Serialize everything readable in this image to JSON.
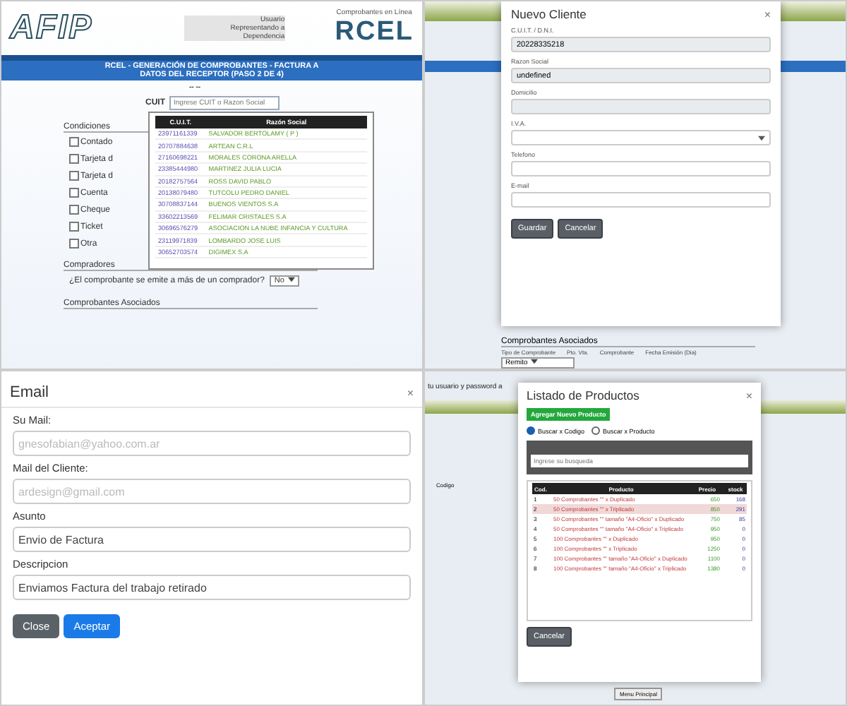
{
  "afip_panel": {
    "logo": "AFIP",
    "header_labels": [
      "Usuario",
      "Representando a",
      "Dependencia"
    ],
    "brand_caption": "Comprobantes en Línea",
    "brand": "RCEL",
    "title_lines": [
      "RCEL - GENERACIÓN DE COMPROBANTES - FACTURA A",
      "DATOS DEL RECEPTOR (PASO 2 DE 4)"
    ],
    "step": "-- --",
    "cuit_label": "CUIT",
    "cuit_placeholder": "Ingrese CUIT o Razon Social",
    "suggestions": {
      "columns": [
        "C.U.I.T.",
        "Razón Social"
      ],
      "rows": [
        {
          "cuit": "23971161339",
          "name": "SALVADOR BERTOLAMY ( P )"
        },
        {
          "cuit": "20707884638",
          "name": "ARTEAN C.R.L"
        },
        {
          "cuit": "27160698221",
          "name": "MORALES CORONA ARELLA"
        },
        {
          "cuit": "23385444980",
          "name": "MARTINEZ JULIA LUCIA"
        },
        {
          "cuit": "20182757564",
          "name": "ROSS DAVID PABLO"
        },
        {
          "cuit": "20138079480",
          "name": "TUTCOLU PEDRO DANIEL"
        },
        {
          "cuit": "30708837144",
          "name": "BUENOS VIENTOS S.A"
        },
        {
          "cuit": "33602213569",
          "name": "FELIMAR CRISTALES S.A"
        },
        {
          "cuit": "30696576279",
          "name": "ASOCIACION LA NUBE INFANCIA Y CULTURA"
        },
        {
          "cuit": "23119971839",
          "name": "LOMBARDO JOSE LUIS"
        },
        {
          "cuit": "30652703574",
          "name": "DIGIMEX S.A"
        }
      ]
    },
    "conditions_label": "Condiciones",
    "conditions": [
      {
        "label": "Contado",
        "checked": false
      },
      {
        "label": "Tarjeta d",
        "checked": false
      },
      {
        "label": "Tarjeta d",
        "checked": false
      },
      {
        "label": "Cuenta",
        "checked": false
      },
      {
        "label": "Cheque",
        "checked": false
      },
      {
        "label": "Ticket",
        "checked": false
      },
      {
        "label": "Otra",
        "checked": false
      }
    ],
    "buyers_label": "Compradores",
    "buyers_question": "¿El comprobante se emite a más de un comprador?",
    "buyers_value": "No",
    "associated_label": "Comprobantes Asociados"
  },
  "client_panel": {
    "title": "Nuevo Cliente",
    "close": "×",
    "fields": [
      {
        "label": "C.U.I.T. / D.N.I.",
        "value": "20228335218",
        "kind": "readonly"
      },
      {
        "label": "Razon Social",
        "value": "undefined",
        "kind": "readonly"
      },
      {
        "label": "Domicilio",
        "kind": "readonly"
      },
      {
        "label": "I.V.A.",
        "kind": "select"
      },
      {
        "label": "Telefono",
        "kind": "text"
      },
      {
        "label": "E-mail",
        "kind": "text"
      }
    ],
    "buttons": [
      "Guardar",
      "Cancelar"
    ],
    "associated_label": "Comprobantes Asociados",
    "associated_columns": [
      "Tipo de Comprobante",
      "Pto. Vta.",
      "Comprobante",
      "Fecha Emisión (Dia)"
    ],
    "associated_type": "Remito"
  },
  "email_panel": {
    "title": "Email",
    "close": "×",
    "fields": [
      {
        "label": "Su Mail:",
        "value": "gnesofabian@yahoo.com.ar",
        "blurred": true
      },
      {
        "label": "Mail del Cliente:",
        "value": "ardesign@gmail.com",
        "blurred": true
      },
      {
        "label": "Asunto",
        "value": "Envio de Factura",
        "blurred": false
      },
      {
        "label": "Descripcion",
        "value": "Enviamos Factura del trabajo retirado",
        "blurred": false
      }
    ],
    "buttons": [
      {
        "label": "Close",
        "kind": "secondary"
      },
      {
        "label": "Aceptar",
        "kind": "primary"
      }
    ]
  },
  "products_panel": {
    "background_text": "tu usuario y password a",
    "background_label": "Codigo",
    "menu_button": "Menu Principal",
    "title": "Listado de Productos",
    "close": "×",
    "add_button": "Agregar Nuevo Producto",
    "search_modes": [
      {
        "label": "Buscar x Codigo",
        "selected": true
      },
      {
        "label": "Buscar x Producto",
        "selected": false
      }
    ],
    "search_placeholder": "Ingrese su busqueda",
    "columns": [
      "Cod.",
      "Producto",
      "Precio",
      "stock"
    ],
    "rows": [
      {
        "cod": "1",
        "product": "50 Comprobantes \"\" x Duplicado",
        "price": "650",
        "stock": "168",
        "selected": false
      },
      {
        "cod": "2",
        "product": "50 Comprobantes \"\" x Triplicado",
        "price": "850",
        "stock": "291",
        "selected": true
      },
      {
        "cod": "3",
        "product": "50 Comprobantes \"\" tamaño \"A4-Oficio\" x Duplicado",
        "price": "750",
        "stock": "85",
        "selected": false
      },
      {
        "cod": "4",
        "product": "50 Comprobantes \"\" tamaño \"A4-Oficio\" x Triplicado",
        "price": "950",
        "stock": "0",
        "selected": false
      },
      {
        "cod": "5",
        "product": "100 Comprobantes \"\" x Duplicado",
        "price": "950",
        "stock": "0",
        "selected": false
      },
      {
        "cod": "6",
        "product": "100 Comprobantes \"\" x Triplicado",
        "price": "1250",
        "stock": "0",
        "selected": false
      },
      {
        "cod": "7",
        "product": "100 Comprobantes \"\" tamaño \"A4-Oficio\" x Duplicado",
        "price": "1100",
        "stock": "0",
        "selected": false
      },
      {
        "cod": "8",
        "product": "100 Comprobantes \"\" tamaño \"A4-Oficio\" x Triplicado",
        "price": "1380",
        "stock": "0",
        "selected": false
      }
    ],
    "cancel_button": "Cancelar"
  }
}
